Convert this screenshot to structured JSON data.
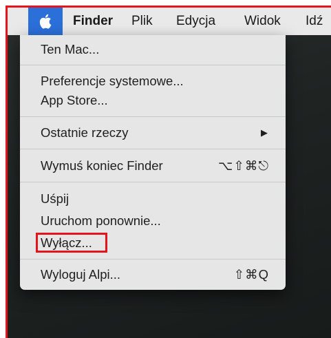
{
  "menubar": {
    "apple_icon": "apple-logo-icon",
    "items": [
      "Finder",
      "Plik",
      "Edycja",
      "Widok",
      "Idź"
    ],
    "accent_color": "#2b6fd9"
  },
  "apple_menu": {
    "about": "Ten Mac...",
    "system_prefs": "Preferencje systemowe...",
    "app_store": "App Store...",
    "recent_items": "Ostatnie rzeczy",
    "force_quit": {
      "label": "Wymuś koniec Finder",
      "shortcut": "⌥⇧⌘⎋"
    },
    "sleep": "Uśpij",
    "restart": "Uruchom ponownie...",
    "shutdown": "Wyłącz...",
    "logout": {
      "label": "Wyloguj Alpi...",
      "shortcut": "⇧⌘Q"
    }
  },
  "highlight_color": "#e4141b"
}
